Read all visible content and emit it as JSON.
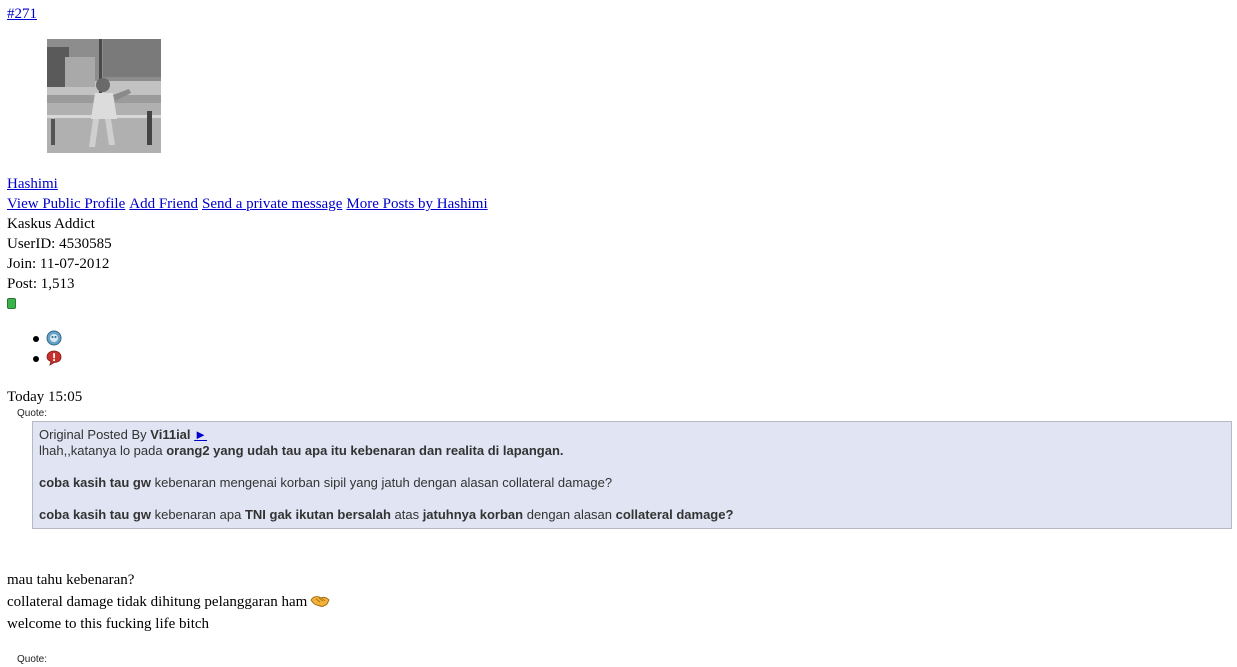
{
  "post": {
    "number": "#271",
    "username": "Hashimi",
    "links": {
      "view_profile": "View Public Profile",
      "add_friend": "Add Friend",
      "send_pm": "Send a private message",
      "more_posts": "More Posts by Hashimi"
    },
    "rank": "Kaskus Addict",
    "user_id": "UserID: 4530585",
    "join": "Join: 11-07-2012",
    "post_count": "Post: 1,513",
    "online_color": "#3bb34a",
    "icons": [
      "reputation-icon",
      "report-icon"
    ],
    "time": "Today 15:05"
  },
  "quote": {
    "label": "Quote:",
    "prefix": "Original Posted By ",
    "author": "Vi11ial",
    "arrow": "►",
    "line1_pre": "lhah,,katanya lo pada ",
    "line1_bold": "orang2 yang udah tau apa itu kebenaran dan realita di lapangan.",
    "line2_bold": "coba kasih tau gw",
    "line2_rest": " kebenaran mengenai korban sipil yang jatuh dengan alasan collateral damage?",
    "line3_bold1": "coba kasih tau gw",
    "line3_t1": " kebenaran apa ",
    "line3_bold2": "TNI gak ikutan bersalah",
    "line3_t2": " atas ",
    "line3_bold3": "jatuhnya korban",
    "line3_t3": " dengan alasan ",
    "line3_bold4": "collateral damage?"
  },
  "body": {
    "line1": "mau tahu kebenaran?",
    "line2": "collateral damage tidak dihitung pelanggaran ham",
    "line2_emoticon": "handshake-emoticon",
    "line3": "welcome to this fucking life bitch"
  },
  "next_quote_label": "Quote:",
  "colors": {
    "link": "#0000cc",
    "quote_bg": "#e1e4f2",
    "quote_border": "#b6b9c5"
  }
}
